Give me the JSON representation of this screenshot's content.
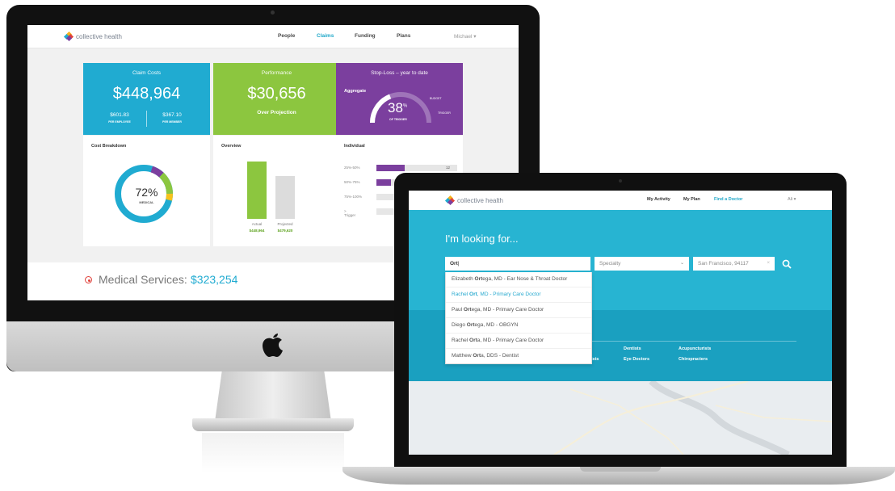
{
  "brand": {
    "name": "collective health"
  },
  "desktop": {
    "nav": {
      "items": [
        "People",
        "Claims",
        "Funding",
        "Plans"
      ],
      "active": "Claims",
      "user": "Michael ▾"
    },
    "claim_costs": {
      "title": "Claim Costs",
      "value": "$448,964",
      "per_employee_value": "$601.83",
      "per_employee_label": "PER EMPLOYEE",
      "per_member_value": "$367.10",
      "per_member_label": "PER MEMBER",
      "color": "#20abd1"
    },
    "performance": {
      "title": "Performance",
      "value": "$30,656",
      "subtitle": "Over Projection",
      "color": "#8cc63f"
    },
    "stop_loss": {
      "title": "Stop-Loss – year to date",
      "aggregate_label": "Aggregate",
      "gauge_percent": 38,
      "gauge_value": "38",
      "gauge_unit": "%",
      "gauge_caption": "OF TRIGGER",
      "budget_label": "BUDGET",
      "trigger_label": "TRIGGER",
      "color": "#7b3f9e"
    },
    "cost_breakdown": {
      "title": "Cost Breakdown",
      "percent": "72%",
      "label": "MEDICAL"
    },
    "overview": {
      "title": "Overview",
      "actual_label": "Actual",
      "actual_value": "$448,964",
      "projected_label": "Projected",
      "projected_value": "$479,620",
      "actual_ratio": 0.94,
      "projected_ratio": 0.7
    },
    "individual": {
      "title": "Individual",
      "rows": [
        {
          "label": "25%-50%",
          "fill": 0.35,
          "count": "12"
        },
        {
          "label": "50%-75%",
          "fill": 0.18,
          "count": ""
        },
        {
          "label": "75%-100%",
          "fill": 0.0,
          "count": ""
        },
        {
          "label": "> Trigger",
          "fill": 0.0,
          "count": ""
        }
      ]
    },
    "medical_services": {
      "label": "Medical Services:",
      "value": "$323,254"
    }
  },
  "laptop": {
    "nav": {
      "items": [
        "My Activity",
        "My Plan",
        "Find a Doctor"
      ],
      "active": "Find a Doctor",
      "user": "Ali ▾"
    },
    "heading": "I'm looking for...",
    "search_value": "Ort",
    "specialty_placeholder": "Specialty",
    "location_value": "San Francisco, 94117",
    "suggestions": [
      {
        "prefix": "Elizabeth ",
        "match": "Ort",
        "suffix": "ega, MD - Ear Nose & Throat Doctor",
        "highlighted": false
      },
      {
        "prefix": "Rachel ",
        "match": "Ort",
        "suffix": ", MD - Primary Care Doctor",
        "highlighted": true
      },
      {
        "prefix": "Paul ",
        "match": "Ort",
        "suffix": "ega, MD - Primary Care Doctor",
        "highlighted": false
      },
      {
        "prefix": "Diego ",
        "match": "Ort",
        "suffix": "ega, MD - OBGYN",
        "highlighted": false
      },
      {
        "prefix": "Rachel ",
        "match": "Ort",
        "suffix": "a, MD - Primary Care Doctor",
        "highlighted": false
      },
      {
        "prefix": "Matthew ",
        "match": "Ort",
        "suffix": "a, DDS - Dentist",
        "highlighted": false
      }
    ],
    "categories": [
      "Dentists",
      "Acupuncturists",
      "ists",
      "Eye Doctors",
      "Chiropracters"
    ]
  }
}
